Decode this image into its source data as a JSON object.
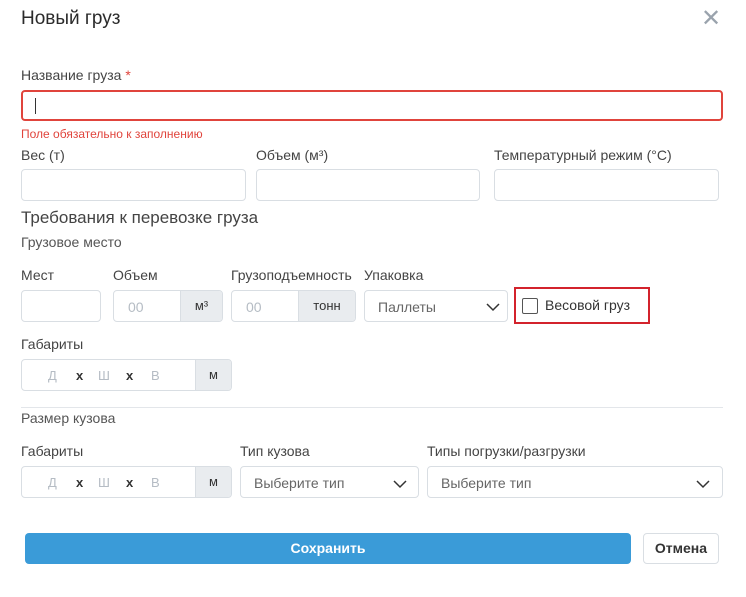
{
  "dialog": {
    "title": "Новый груз",
    "close_icon": "close-icon"
  },
  "cargo_name": {
    "label": "Название груза",
    "required_mark": "*",
    "value": "",
    "error": "Поле обязательно к заполнению"
  },
  "weight": {
    "label": "Вес (т)",
    "value": ""
  },
  "volume": {
    "label": "Объем (м³)",
    "value": ""
  },
  "temperature": {
    "label": "Температурный режим (°C)",
    "value": ""
  },
  "requirements": {
    "title": "Требования к перевозке груза",
    "cargo_place": "Грузовое место",
    "places_label": "Мест",
    "volume_label": "Объем",
    "volume_placeholder": "00",
    "volume_unit": "м³",
    "capacity_label": "Грузоподъемность",
    "capacity_placeholder": "00",
    "capacity_unit": "тонн",
    "packaging_label": "Упаковка",
    "packaging_value": "Паллеты",
    "weight_cargo_label": "Весовой груз",
    "weight_cargo_checked": false,
    "dims_label": "Габариты",
    "dims": {
      "d": "Д",
      "w": "Ш",
      "h": "В",
      "sep": "x",
      "unit": "м"
    }
  },
  "body_size": {
    "title": "Размер кузова",
    "dims_label": "Габариты",
    "dims": {
      "d": "Д",
      "w": "Ш",
      "h": "В",
      "sep": "x",
      "unit": "м"
    },
    "body_type_label": "Тип кузова",
    "body_type_placeholder": "Выберите тип",
    "loading_label": "Типы погрузки/разгрузки",
    "loading_placeholder": "Выберите тип"
  },
  "actions": {
    "save": "Сохранить",
    "cancel": "Отмена"
  },
  "colors": {
    "primary": "#3a9bd8",
    "error": "#e0443c",
    "highlight": "#d3232c"
  }
}
